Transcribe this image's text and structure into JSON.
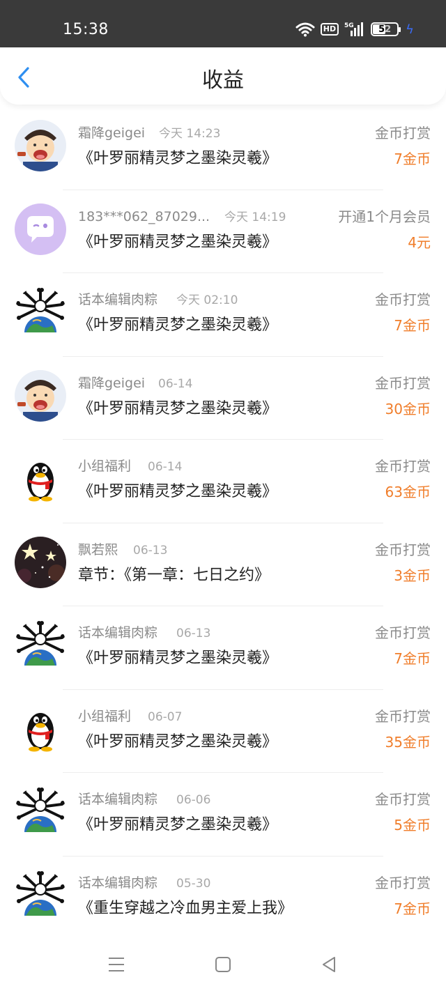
{
  "status": {
    "time": "15:38",
    "hd": "HD",
    "network": "5G",
    "battery": "52"
  },
  "header": {
    "title": "收益"
  },
  "rows": [
    {
      "name": "霜降geigei",
      "time": "今天 14:23",
      "book": "《叶罗丽精灵梦之墨染灵羲》",
      "type": "金币打赏",
      "amount": "7金币",
      "avatar": "cartoon-boy"
    },
    {
      "name": "183***062_87029...",
      "time": "今天 14:19",
      "book": "《叶罗丽精灵梦之墨染灵羲》",
      "type": "开通1个月会员",
      "amount": "4元",
      "avatar": "chat-bubble"
    },
    {
      "name": "话本编辑肉粽",
      "time": "今天 02:10",
      "book": "《叶罗丽精灵梦之墨染灵羲》",
      "type": "金币打赏",
      "amount": "7金币",
      "avatar": "earth-bones"
    },
    {
      "name": "霜降geigei",
      "time": "06-14",
      "book": "《叶罗丽精灵梦之墨染灵羲》",
      "type": "金币打赏",
      "amount": "30金币",
      "avatar": "cartoon-boy"
    },
    {
      "name": "小组福利",
      "time": "06-14",
      "book": "《叶罗丽精灵梦之墨染灵羲》",
      "type": "金币打赏",
      "amount": "63金币",
      "avatar": "penguin"
    },
    {
      "name": "飘若熙",
      "time": "06-13",
      "book": "章节：《第一章：七日之约》",
      "type": "金币打赏",
      "amount": "3金币",
      "avatar": "stars"
    },
    {
      "name": "话本编辑肉粽",
      "time": "06-13",
      "book": "《叶罗丽精灵梦之墨染灵羲》",
      "type": "金币打赏",
      "amount": "7金币",
      "avatar": "earth-bones"
    },
    {
      "name": "小组福利",
      "time": "06-07",
      "book": "《叶罗丽精灵梦之墨染灵羲》",
      "type": "金币打赏",
      "amount": "35金币",
      "avatar": "penguin"
    },
    {
      "name": "话本编辑肉粽",
      "time": "06-06",
      "book": "《叶罗丽精灵梦之墨染灵羲》",
      "type": "金币打赏",
      "amount": "5金币",
      "avatar": "earth-bones"
    },
    {
      "name": "话本编辑肉粽",
      "time": "05-30",
      "book": "《重生穿越之冷血男主爱上我》",
      "type": "金币打赏",
      "amount": "7金币",
      "avatar": "earth-bones"
    }
  ],
  "colors": {
    "accent": "#2f8ff0",
    "amount": "#f07d2a",
    "status_bar": "#3a3a3a"
  }
}
